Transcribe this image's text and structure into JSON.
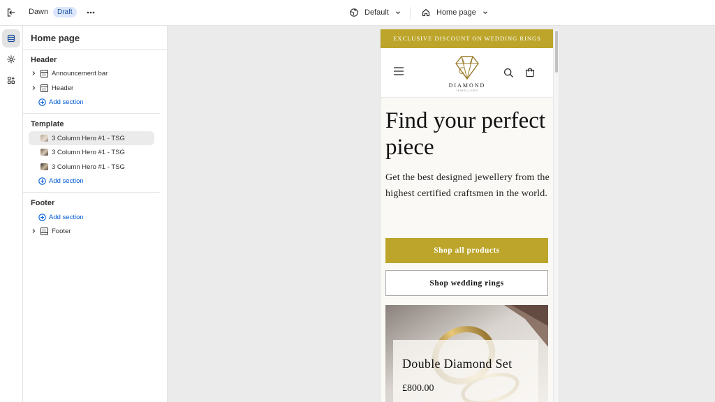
{
  "topbar": {
    "theme_name": "Dawn",
    "draft_badge": "Draft",
    "view_selector": "Default",
    "page_selector": "Home page"
  },
  "sidebar": {
    "title": "Home page",
    "groups": [
      {
        "title": "Header",
        "items": [
          "Announcement bar",
          "Header"
        ],
        "add_label": "Add section"
      },
      {
        "title": "Template",
        "items": [
          "3 Column Hero #1 - TSG",
          "3 Column Hero #1 - TSG",
          "3 Column Hero #1 - TSG"
        ],
        "add_label": "Add section"
      },
      {
        "title": "Footer",
        "add_label": "Add section",
        "items": [
          "Footer"
        ]
      }
    ]
  },
  "preview": {
    "announcement": "EXCLUSIVE DISCOUNT ON WEDDING RINGS",
    "logo_name": "DIAMOND",
    "logo_sub": "JEWELLERY",
    "hero_title": "Find your perfect piece",
    "hero_text": "Get the best designed jewellery from the highest certified craftsmen in the world.",
    "primary_button": "Shop all products",
    "secondary_button": "Shop wedding rings",
    "card_title": "Double Diamond Set",
    "card_price": "£800.00"
  },
  "colors": {
    "accent_gold": "#bca52a",
    "link_blue": "#005bd3",
    "draft_badge_bg": "#dbe7fb"
  }
}
